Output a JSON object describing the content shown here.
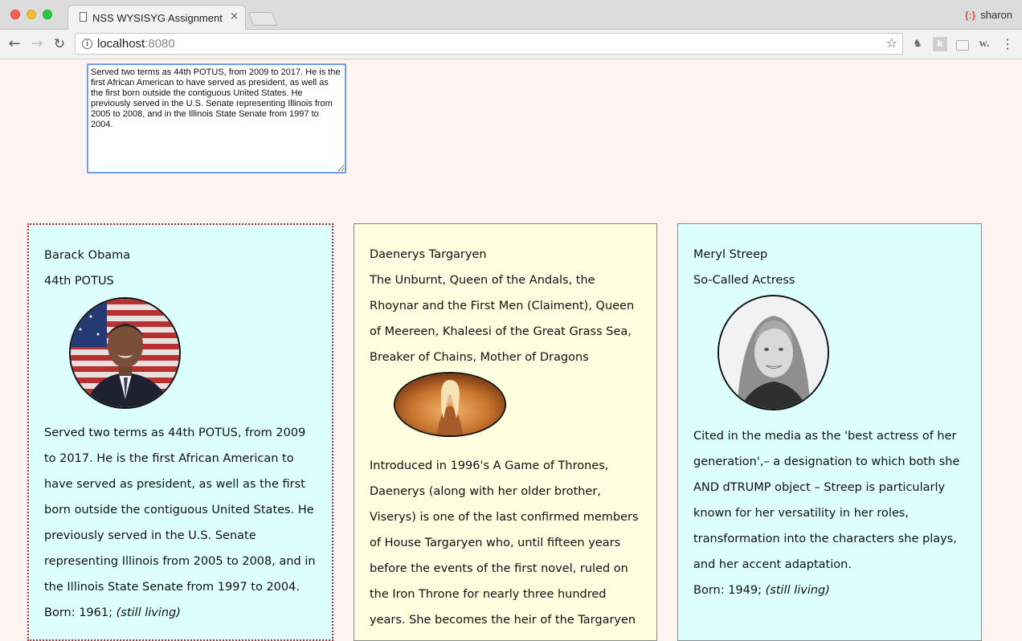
{
  "browser": {
    "tab_title": "NSS WYSISYG Assignment",
    "tab_close": "×",
    "profile_name": "sharon",
    "url_host": "localhost",
    "url_port": ":8080"
  },
  "editor": {
    "value": "Served two terms as 44th POTUS, from 2009 to 2017. He is the first African American to have served as president, as well as the first born outside the contiguous United States. He previously served in the U.S. Senate representing Illinois from 2005 to 2008, and in the Illinois State Senate from 1997 to 2004."
  },
  "cards": [
    {
      "name": "Barack Obama",
      "title": "44th POTUS",
      "bio": "Served two terms as 44th POTUS, from 2009 to 2017. He is the first African American to have served as president, as well as the first born outside the contiguous United States. He previously served in the U.S. Senate representing Illinois from 2005 to 2008, and in the Illinois State Senate from 1997 to 2004.",
      "born_prefix": "Born: 1961;",
      "born_status": "(still living)",
      "selected": true
    },
    {
      "name": "Daenerys Targaryen",
      "title": "The Unburnt, Queen of the Andals, the Rhoynar and the First Men (Claiment), Queen of Meereen, Khaleesi of the Great Grass Sea, Breaker of Chains, Mother of Dragons",
      "bio": "Introduced in 1996's A Game of Thrones, Daenerys (along with her older brother, Viserys) is one of the last confirmed members of House Targaryen who, until fifteen years before the events of the first novel, ruled on the Iron Throne for nearly three hundred years. She becomes the heir of the Targaryen dynasty after her brother's",
      "selected": false
    },
    {
      "name": "Meryl Streep",
      "title": "So-Called Actress",
      "bio": "Cited in the media as the 'best actress of her generation',– a designation to which both she AND dTRUMP object – Streep is particularly known for her versatility in her roles, transformation into the characters she plays, and her accent adaptation.",
      "born_prefix": "Born: 1949;",
      "born_status": "(still living)",
      "selected": false
    }
  ],
  "colors": {
    "page_bg": "#fdf3f0",
    "card_cyan": "#dcfefe",
    "card_yellow": "#fdfde0",
    "selected_border": "#c8282a",
    "editor_focus": "#6b9fe6"
  }
}
